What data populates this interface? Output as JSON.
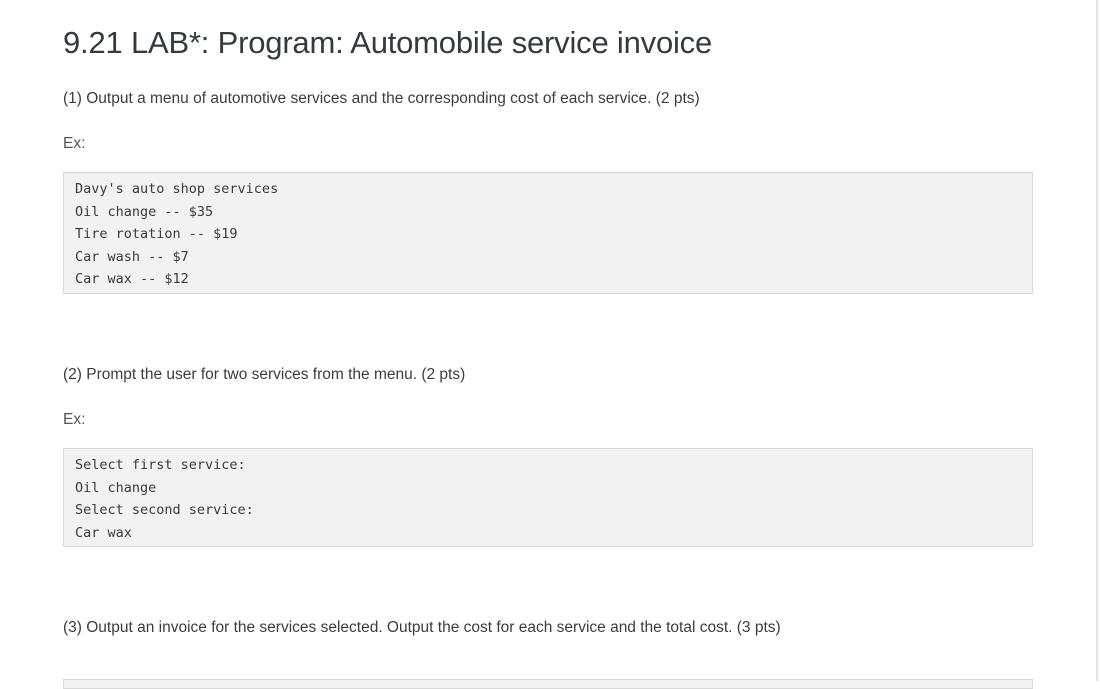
{
  "title": "9.21 LAB*: Program: Automobile service invoice",
  "sections": [
    {
      "text": "(1) Output a menu of automotive services and the corresponding cost of each service. (2 pts)",
      "ex_label": "Ex:",
      "code_lines": [
        "Davy's auto shop services",
        "Oil change -- $35",
        "Tire rotation -- $19",
        "Car wash -- $7",
        "Car wax -- $12"
      ]
    },
    {
      "text": "(2) Prompt the user for two services from the menu. (2 pts)",
      "ex_label": "Ex:",
      "code_lines": [
        "Select first service:",
        "Oil change",
        "Select second service:",
        "Car wax"
      ]
    },
    {
      "text": "(3) Output an invoice for the services selected. Output the cost for each service and the total cost. (3 pts)"
    }
  ]
}
